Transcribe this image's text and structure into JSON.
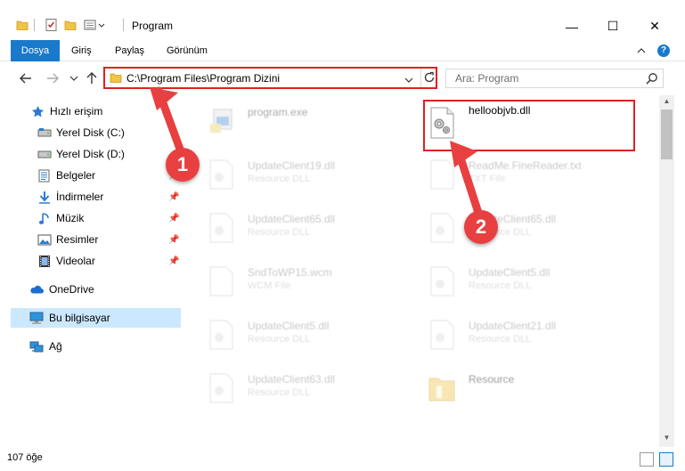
{
  "window": {
    "title": "Program",
    "minimize": "—",
    "maximize": "☐",
    "close": "✕"
  },
  "ribbon": {
    "tabs": [
      "Dosya",
      "Giriş",
      "Paylaş",
      "Görünüm"
    ]
  },
  "navbar": {
    "address": "C:\\Program Files\\Program Dizini",
    "search_placeholder": "Ara: Program"
  },
  "sidebar": {
    "items": [
      {
        "label": "Hızlı erişim",
        "icon": "star-icon"
      },
      {
        "label": "Yerel Disk (C:)",
        "icon": "drive-icon"
      },
      {
        "label": "Yerel Disk (D:)",
        "icon": "drive-icon"
      },
      {
        "label": "Belgeler",
        "icon": "documents-icon"
      },
      {
        "label": "İndirmeler",
        "icon": "download-icon"
      },
      {
        "label": "Müzik",
        "icon": "music-icon"
      },
      {
        "label": "Resimler",
        "icon": "pictures-icon"
      },
      {
        "label": "Videolar",
        "icon": "video-icon"
      },
      {
        "label": "OneDrive",
        "icon": "cloud-icon"
      },
      {
        "label": "Bu bilgisayar",
        "icon": "computer-icon"
      },
      {
        "label": "Ağ",
        "icon": "network-icon"
      }
    ]
  },
  "files": [
    {
      "name": "program.exe",
      "type": ""
    },
    {
      "name": "helloobjvb.dll",
      "type": ""
    },
    {
      "name": "UpdateClient19.dll",
      "type": "Resource DLL"
    },
    {
      "name": "ReadMe.FineReader.txt",
      "type": "TXT File"
    },
    {
      "name": "UpdateClient65.dll",
      "type": "Resource DLL"
    },
    {
      "name": "UpdateClient65.dll",
      "type": "Resource DLL"
    },
    {
      "name": "SndToWP15.wcm",
      "type": "WCM File"
    },
    {
      "name": "UpdateClient5.dll",
      "type": "Resource DLL"
    },
    {
      "name": "UpdateClient5.dll",
      "type": "Resource DLL"
    },
    {
      "name": "UpdateClient21.dll",
      "type": "Resource DLL"
    },
    {
      "name": "UpdateClient63.dll",
      "type": "Resource DLL"
    },
    {
      "name": "Resource",
      "type": ""
    }
  ],
  "status": {
    "count": "107 öğe"
  },
  "annotations": {
    "badge1": "1",
    "badge2": "2",
    "color": "#e84040"
  },
  "colors": {
    "accent": "#1979ca",
    "selected": "#cce8ff",
    "highlight": "#e02020"
  }
}
